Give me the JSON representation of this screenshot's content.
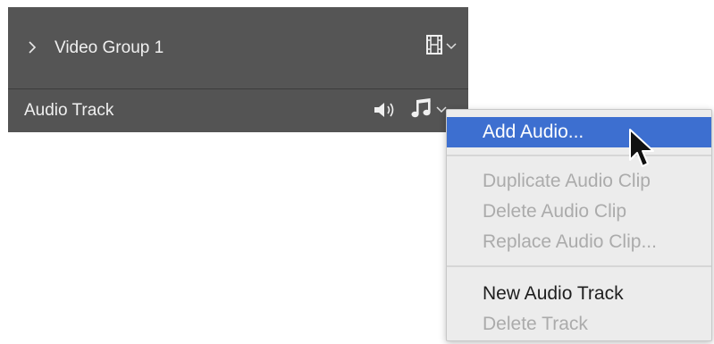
{
  "timeline": {
    "video_group": {
      "label": "Video Group 1",
      "icon": "film-strip-icon",
      "dropdown_icon": "chevron-down-icon"
    },
    "audio_track": {
      "label": "Audio Track",
      "speaker_icon": "speaker-icon",
      "music_icon": "music-note-icon",
      "dropdown_icon": "chevron-down-icon"
    }
  },
  "context_menu": {
    "groups": [
      [
        {
          "label": "Add Audio...",
          "state": "highlighted"
        }
      ],
      [
        {
          "label": "Duplicate Audio Clip",
          "state": "disabled"
        },
        {
          "label": "Delete Audio Clip",
          "state": "disabled"
        },
        {
          "label": "Replace Audio Clip...",
          "state": "disabled"
        }
      ],
      [
        {
          "label": "New Audio Track",
          "state": "enabled"
        },
        {
          "label": "Delete Track",
          "state": "disabled"
        }
      ]
    ]
  },
  "colors": {
    "panel_bg": "#545454",
    "menu_bg": "#ececec",
    "highlight": "#3d6fd0",
    "disabled_text": "#ababab"
  }
}
